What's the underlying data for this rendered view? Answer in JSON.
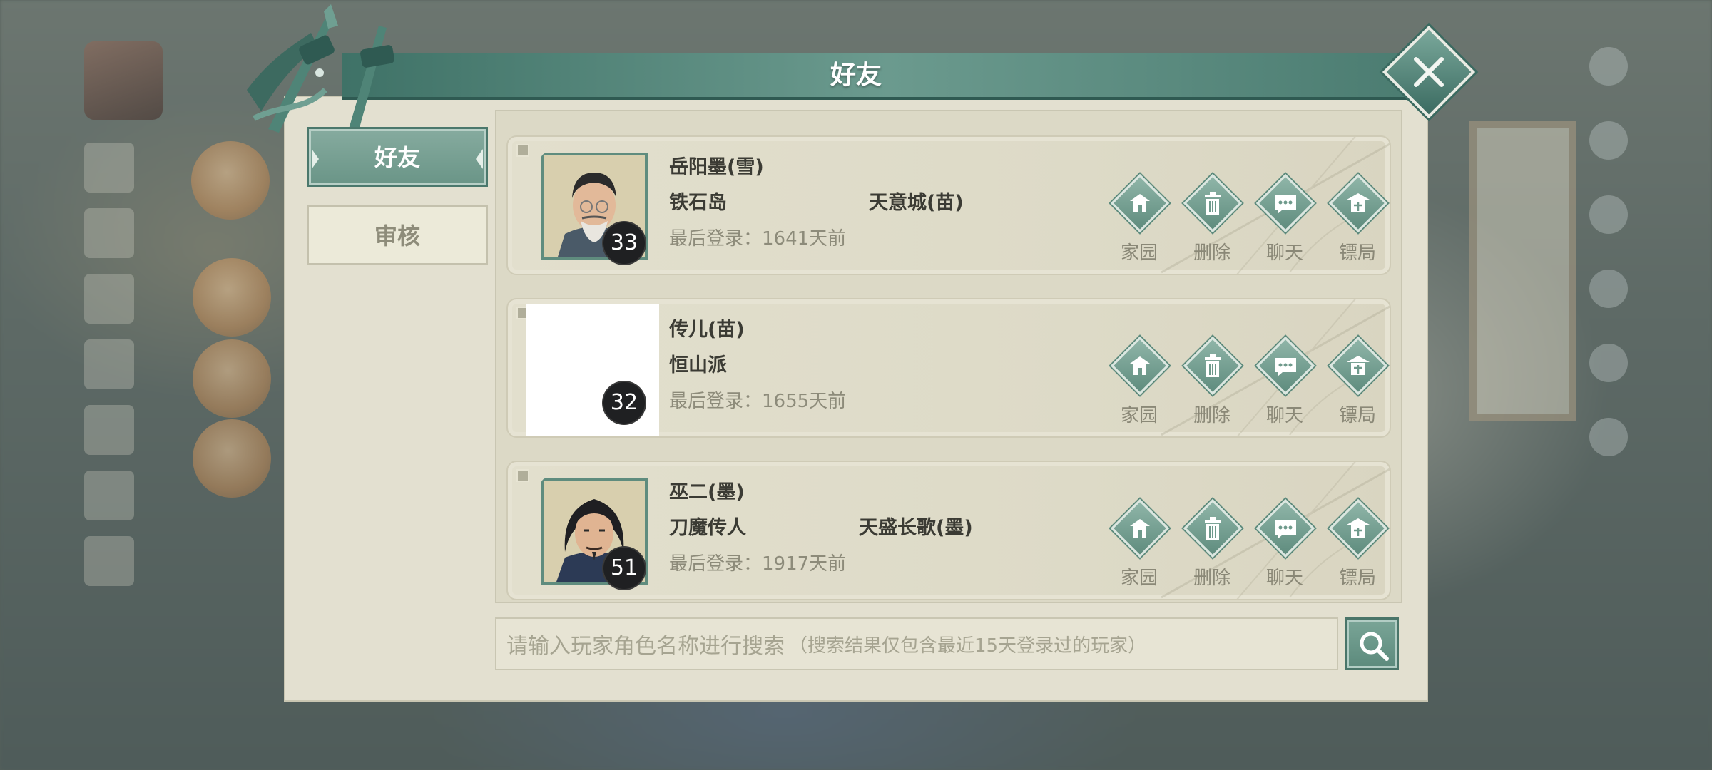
{
  "dialog": {
    "title": "好友",
    "close_icon": "close-icon"
  },
  "tabs": [
    {
      "label": "好友",
      "active": true
    },
    {
      "label": "审核",
      "active": false
    }
  ],
  "friends": [
    {
      "name": "岳阳墨(雪)",
      "sect": "铁石岛",
      "guild": "天意城(苗)",
      "last_login": "最后登录：1641天前",
      "level": "33",
      "avatar": "elder-with-beard"
    },
    {
      "name": "传儿(苗)",
      "sect": "恒山派",
      "guild": "",
      "last_login": "最后登录：1655天前",
      "level": "32",
      "avatar": "blank"
    },
    {
      "name": "巫二(墨)",
      "sect": "刀魔传人",
      "guild": "天盛长歌(墨)",
      "last_login": "最后登录：1917天前",
      "level": "51",
      "avatar": "young-swordsman"
    }
  ],
  "actions": {
    "home": {
      "label": "家园",
      "icon": "home-icon"
    },
    "delete": {
      "label": "删除",
      "icon": "trash-icon"
    },
    "chat": {
      "label": "聊天",
      "icon": "chat-icon"
    },
    "escort": {
      "label": "镖局",
      "icon": "escort-icon"
    }
  },
  "search": {
    "placeholder": "请输入玩家角色名称进行搜索",
    "hint": "（搜索结果仅包含最近15天登录过的玩家）",
    "button_icon": "search-icon"
  },
  "colors": {
    "accent": "#5f8c7e",
    "panel": "#e3e0d0",
    "title_bar": "#4a7b70"
  }
}
